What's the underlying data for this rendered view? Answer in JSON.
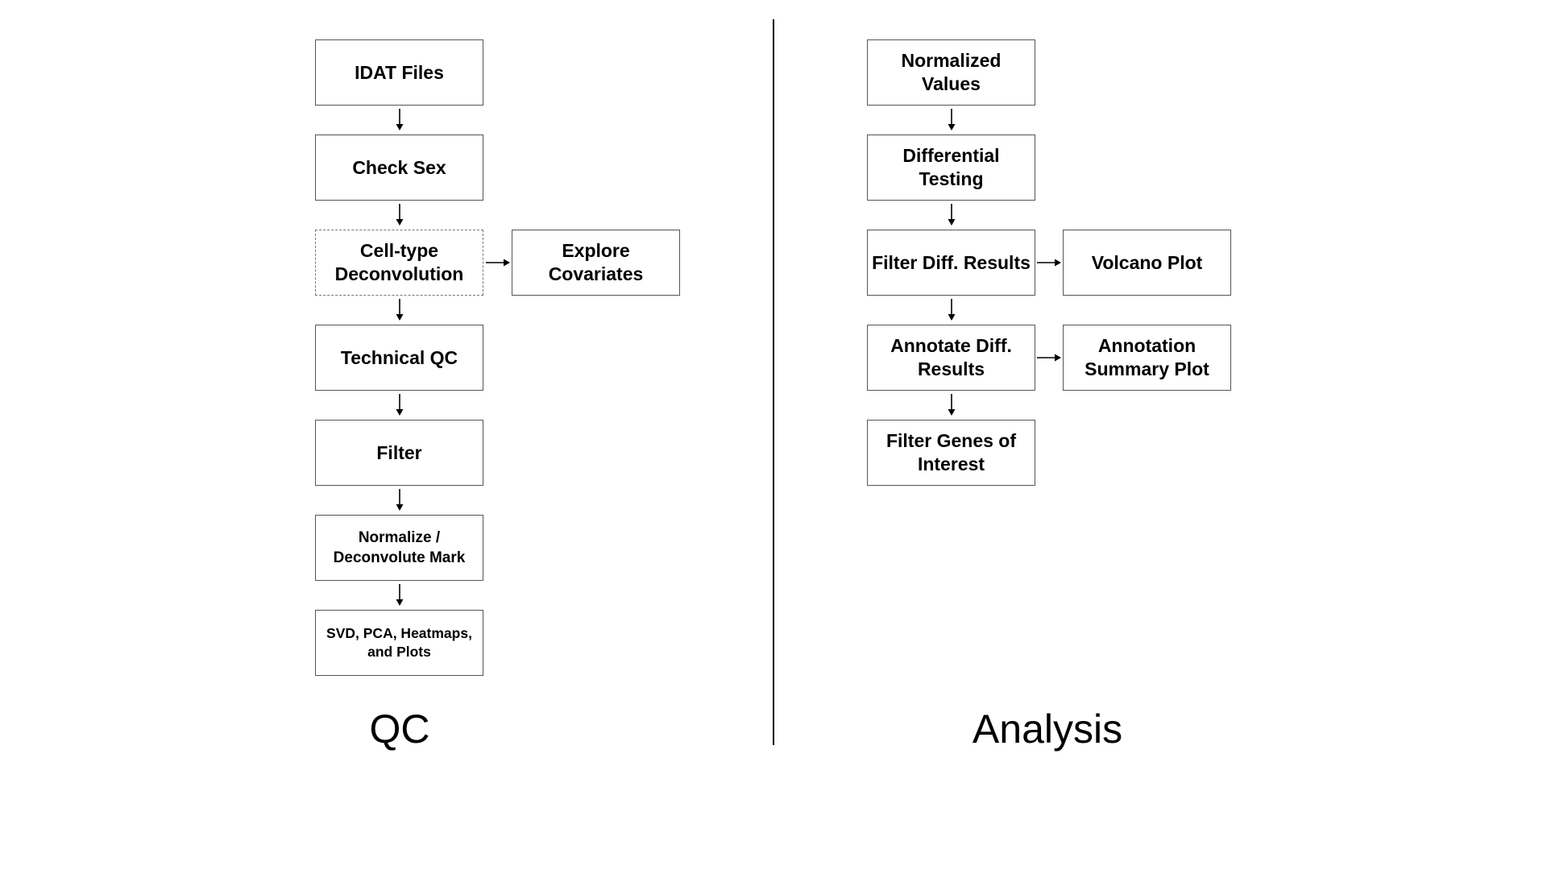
{
  "qc": {
    "title": "QC",
    "steps": [
      "IDAT Files",
      "Check Sex",
      "Cell-type\nDeconvolution",
      "Technical QC",
      "Filter",
      "Normalize /\nDeconvolute Mark",
      "SVD, PCA, Heatmaps,\nand Plots"
    ],
    "side": {
      "from_step": 3,
      "label": "Explore\nCovariates"
    },
    "dashed_step": 3
  },
  "analysis": {
    "title": "Analysis",
    "steps": [
      "Normalized\nValues",
      "Differential\nTesting",
      "Filter Diff. Results",
      "Annotate Diff.\nResults",
      "Filter Genes of\nInterest"
    ],
    "side": [
      {
        "from_step": 3,
        "label": "Volcano Plot"
      },
      {
        "from_step": 4,
        "label": "Annotation\nSummary Plot"
      }
    ]
  }
}
